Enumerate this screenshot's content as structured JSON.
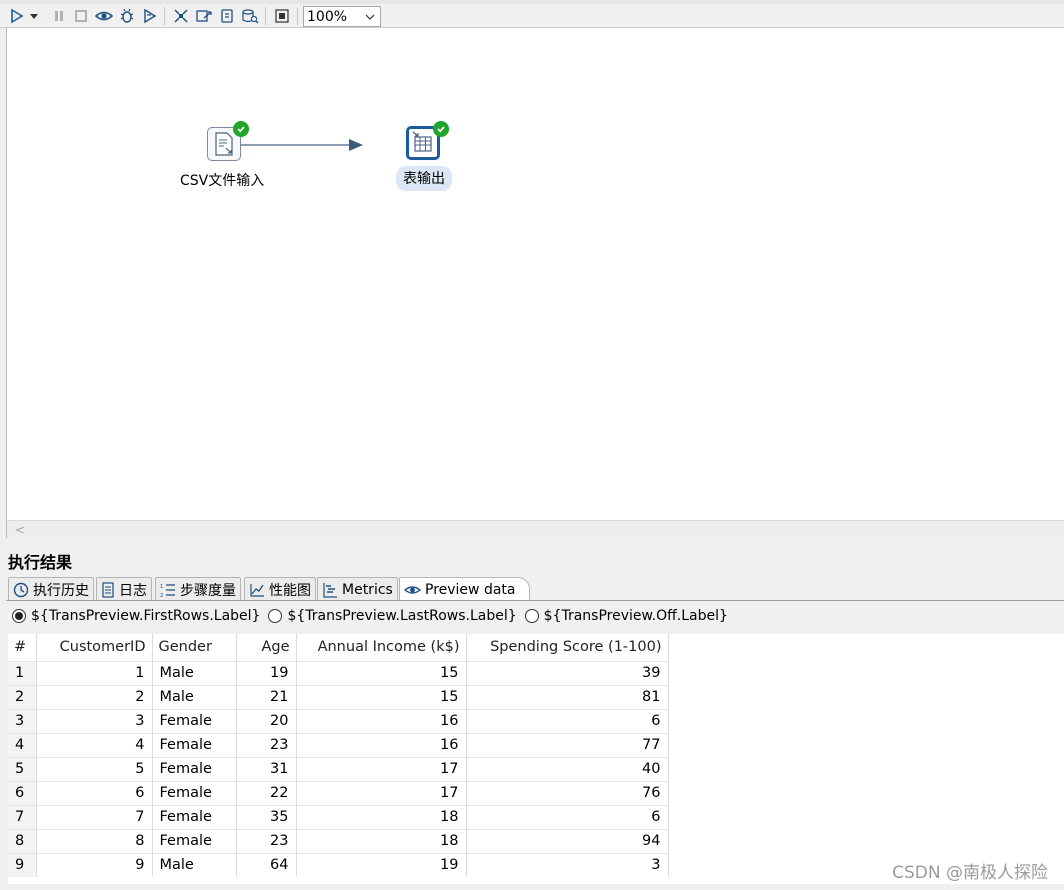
{
  "toolbar": {
    "zoom": "100%",
    "icons": [
      "run-icon",
      "run-dropdown-icon",
      "pause-icon",
      "stop-icon",
      "preview-icon",
      "debug-icon",
      "replay-icon",
      "verify-icon",
      "impact-icon",
      "sql-icon",
      "explore-db-icon",
      "grid-icon"
    ]
  },
  "canvas": {
    "steps": [
      {
        "label": "CSV文件输入",
        "icon": "csv-input-icon",
        "status": "ok"
      },
      {
        "label": "表输出",
        "icon": "table-output-icon",
        "status": "ok"
      }
    ]
  },
  "results": {
    "title": "执行结果",
    "tabs": [
      {
        "label": "执行历史",
        "icon": "history-icon"
      },
      {
        "label": "日志",
        "icon": "log-icon"
      },
      {
        "label": "步骤度量",
        "icon": "step-metrics-icon"
      },
      {
        "label": "性能图",
        "icon": "performance-icon"
      },
      {
        "label": "Metrics",
        "icon": "metrics-icon"
      },
      {
        "label": "Preview data",
        "icon": "preview-eye-icon"
      }
    ],
    "active_tab": "Preview data",
    "radio_options": [
      {
        "label": "${TransPreview.FirstRows.Label}",
        "selected": true
      },
      {
        "label": "${TransPreview.LastRows.Label}",
        "selected": false
      },
      {
        "label": "${TransPreview.Off.Label}",
        "selected": false
      }
    ]
  },
  "table": {
    "headers": [
      "#",
      "CustomerID",
      "Gender",
      "Age",
      "Annual Income (k$)",
      "Spending Score (1-100)"
    ],
    "rows": [
      [
        "1",
        "1",
        "Male",
        "19",
        "15",
        "39"
      ],
      [
        "2",
        "2",
        "Male",
        "21",
        "15",
        "81"
      ],
      [
        "3",
        "3",
        "Female",
        "20",
        "16",
        "6"
      ],
      [
        "4",
        "4",
        "Female",
        "23",
        "16",
        "77"
      ],
      [
        "5",
        "5",
        "Female",
        "31",
        "17",
        "40"
      ],
      [
        "6",
        "6",
        "Female",
        "22",
        "17",
        "76"
      ],
      [
        "7",
        "7",
        "Female",
        "35",
        "18",
        "6"
      ],
      [
        "8",
        "8",
        "Female",
        "23",
        "18",
        "94"
      ],
      [
        "9",
        "9",
        "Male",
        "64",
        "19",
        "3"
      ]
    ]
  },
  "watermark": "CSDN @南极人探险"
}
